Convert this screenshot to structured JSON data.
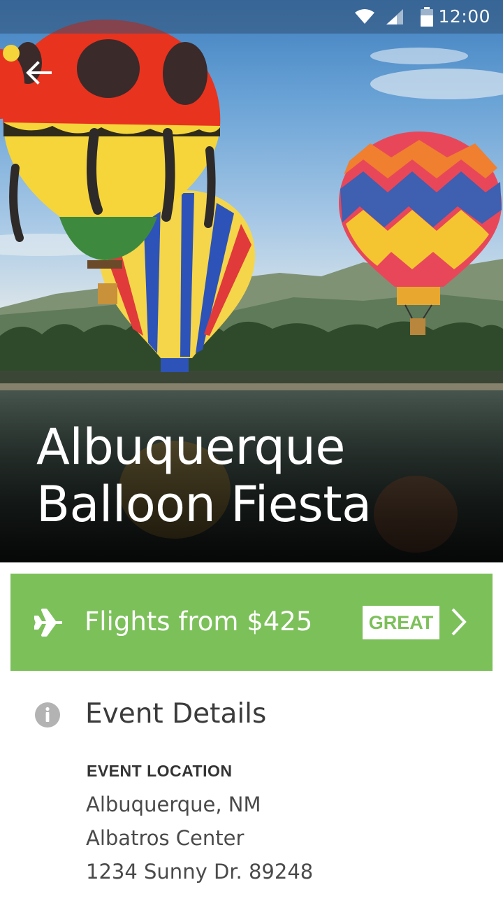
{
  "status_bar": {
    "time": "12:00",
    "icons": [
      "wifi-icon",
      "signal-icon",
      "battery-icon"
    ]
  },
  "hero": {
    "title_line1": "Albuquerque",
    "title_line2": "Balloon Fiesta",
    "back_icon": "arrow-left-icon"
  },
  "flights": {
    "icon": "airplane-icon",
    "label": "Flights from $425",
    "badge": "GREAT",
    "chevron_icon": "chevron-right-icon",
    "color": "#7cc05a"
  },
  "details": {
    "icon": "info-icon",
    "title": "Event Details",
    "location_label": "EVENT LOCATION",
    "location_lines": [
      "Albuquerque, NM",
      "Albatros Center",
      "1234 Sunny Dr. 89248"
    ]
  }
}
